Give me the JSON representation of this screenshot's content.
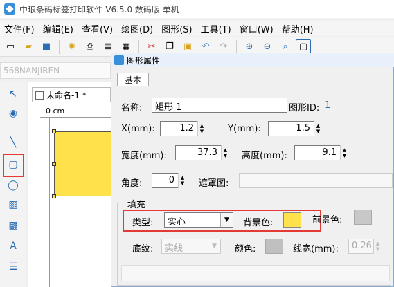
{
  "app": {
    "title": "中琅条码标签打印软件-V6.5.0 数码版 单机"
  },
  "menu": [
    "文件(F)",
    "编辑(E)",
    "查看(V)",
    "绘图(D)",
    "图形(S)",
    "工具(T)",
    "窗口(W)",
    "帮助(H)"
  ],
  "toolbar_icons": [
    "new-icon",
    "open-icon",
    "save-icon",
    "settings-icon",
    "print-icon",
    "preview-icon",
    "cut-icon",
    "copy-icon",
    "paste-icon",
    "undo-icon",
    "redo-icon",
    "zoom-in-icon",
    "zoom-out-icon",
    "zoom-fit-icon",
    "rounded-rect-icon"
  ],
  "namebar": {
    "text": "568NANJIREN"
  },
  "document": {
    "tab_label": "未命名-1 *",
    "ruler_label": "0 cm",
    "shape_color": "#ffe14c"
  },
  "dialog": {
    "title": "图形属性",
    "tab": "基本",
    "name_label": "名称:",
    "name_value": "矩形 1",
    "id_label": "图形ID:",
    "id_value": "1",
    "x_label": "X(mm):",
    "x_value": "1.2",
    "y_label": "Y(mm):",
    "y_value": "1.5",
    "width_label": "宽度(mm):",
    "width_value": "37.3",
    "height_label": "高度(mm):",
    "height_value": "9.1",
    "angle_label": "角度:",
    "angle_value": "0",
    "mask_label": "遮罩图:",
    "fill_group": "填充",
    "type_label": "类型:",
    "type_value": "实心",
    "bgcolor_label": "背景色:",
    "bgcolor": "#ffe14c",
    "fgcolor_label": "前景色:",
    "fgcolor": "#c8c8c8",
    "pattern_label": "底纹:",
    "pattern_value": "实线",
    "color_label": "颜色:",
    "color_value": "#c0c0c0",
    "linewidth_label": "线宽(mm):",
    "linewidth_value": "0.26"
  }
}
